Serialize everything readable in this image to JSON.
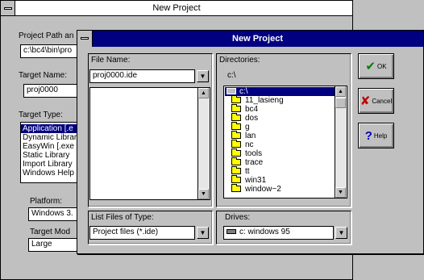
{
  "back_dialog": {
    "title": "New Project",
    "project_path_label": "Project Path an",
    "project_path_value": "c:\\bc4\\bin\\pro",
    "target_name_label": "Target Name:",
    "target_name_value": "proj0000",
    "target_type_label": "Target Type:",
    "target_types": [
      "Application [.e",
      "Dynamic Librar",
      "EasyWin [.exe",
      "Static Library",
      "Import Library",
      "Windows Help"
    ],
    "platform_label": "Platform:",
    "platform_value": "Windows 3.",
    "target_model_label": "Target Mod",
    "target_model_value": "Large"
  },
  "front_dialog": {
    "title": "New Project",
    "file_name_label": "File Name:",
    "file_name_value": "proj0000.ide",
    "directories_label": "Directories:",
    "current_dir": "c:\\",
    "dir_root": "c:\\",
    "directories": [
      "11_lasieng",
      "bc4",
      "dos",
      "g",
      "lan",
      "nc",
      "tools",
      "trace",
      "tt",
      "win31",
      "window~2"
    ],
    "list_files_label": "List Files of Type:",
    "file_type_value": "Project files (*.ide)",
    "drives_label": "Drives:",
    "drive_value": "c: windows 95",
    "ok_label": "OK",
    "cancel_label": "Cancel",
    "help_label": "Help"
  },
  "colors": {
    "title_active": "#000080",
    "dialog_face": "#c0c0c0",
    "folder": "#ffff00"
  }
}
